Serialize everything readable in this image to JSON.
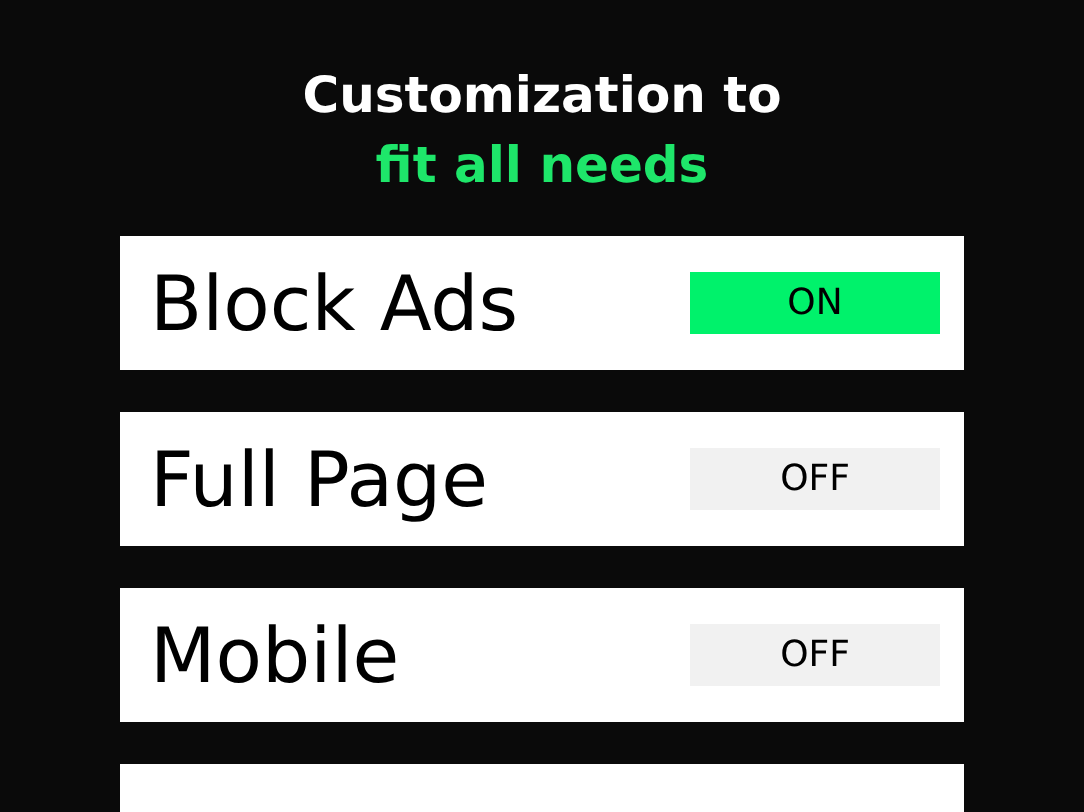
{
  "heading": {
    "line_1": "Customization to",
    "line_2": "fit all needs"
  },
  "settings": [
    {
      "label": "Block Ads",
      "on": true,
      "toggle_text": "ON"
    },
    {
      "label": "Full Page",
      "on": false,
      "toggle_text": "OFF"
    },
    {
      "label": "Mobile",
      "on": false,
      "toggle_text": "OFF"
    }
  ]
}
